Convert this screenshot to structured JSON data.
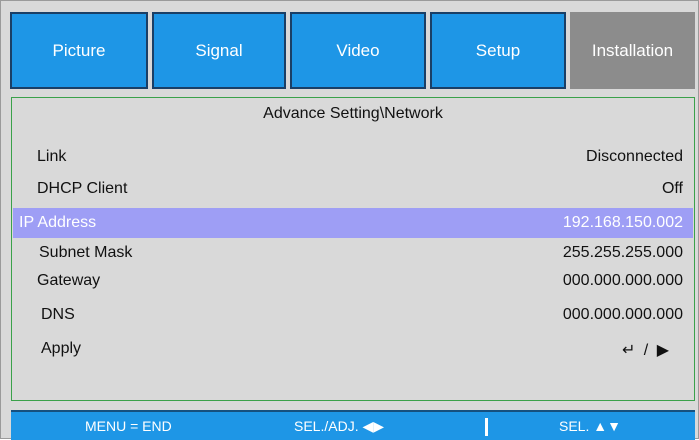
{
  "tabs": [
    {
      "label": "Picture",
      "active": false
    },
    {
      "label": "Signal",
      "active": false
    },
    {
      "label": "Video",
      "active": false
    },
    {
      "label": "Setup",
      "active": false
    },
    {
      "label": "Installation",
      "active": true
    }
  ],
  "panel": {
    "title": "Advance Setting\\Network",
    "rows": [
      {
        "label": "Link",
        "value": "Disconnected",
        "selected": false
      },
      {
        "label": "DHCP Client",
        "value": "Off",
        "selected": false
      },
      {
        "label": "IP Address",
        "value": "192.168.150.002",
        "selected": true
      },
      {
        "label": "Subnet Mask",
        "value": "255.255.255.000",
        "selected": false
      },
      {
        "label": "Gateway",
        "value": "000.000.000.000",
        "selected": false
      },
      {
        "label": "DNS",
        "value": "000.000.000.000",
        "selected": false
      },
      {
        "label": "Apply",
        "value": "↵ / ▶",
        "selected": false
      }
    ]
  },
  "footer": {
    "menu_end": "MENU = END",
    "sel_adj": "SEL./ADJ. ◀▶",
    "sel": "SEL. ▲▼"
  },
  "colors": {
    "tab_blue": "#1e96e6",
    "tab_active_gray": "#8c8c8c",
    "highlight": "#9e9ef5",
    "panel_bg": "#d9d9d9"
  }
}
